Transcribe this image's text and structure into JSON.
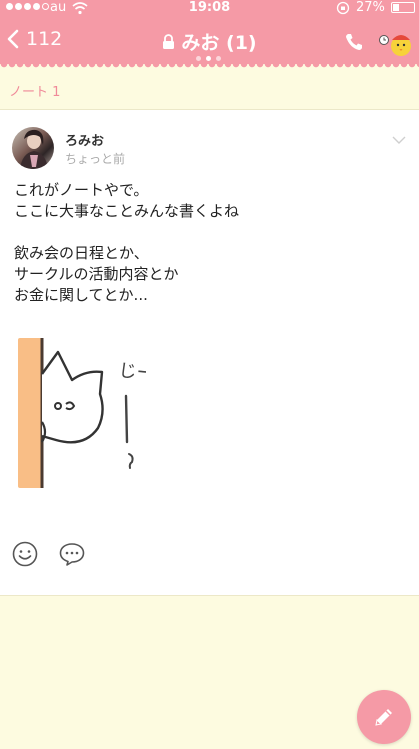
{
  "status_bar": {
    "carrier": "au",
    "time": "19:08",
    "battery_percent": "27%"
  },
  "nav": {
    "back_label": "112",
    "title": "みお (1)",
    "pager_active_index": 1,
    "pager_count": 3
  },
  "note_bar": {
    "label": "ノート 1"
  },
  "post": {
    "author": "ろみお",
    "timestamp": "ちょっと前",
    "text": "これがノートやで。\nここに大事なことみんな書くよね\n\n飲み会の日程とか、\nサークルの活動内容とか\nお金に関してとか...",
    "sticker_text": "じー!?"
  },
  "icons": {
    "back": "chevron-left-icon",
    "lock": "lock-icon",
    "phone": "phone-icon",
    "mascot": "mascot-icon",
    "more": "chevron-down-icon",
    "reaction": "smile-icon",
    "comment": "comment-icon",
    "compose": "pencil-icon"
  },
  "colors": {
    "accent": "#f59aa6",
    "background": "#fdfbe0",
    "note_label": "#f08a99"
  }
}
